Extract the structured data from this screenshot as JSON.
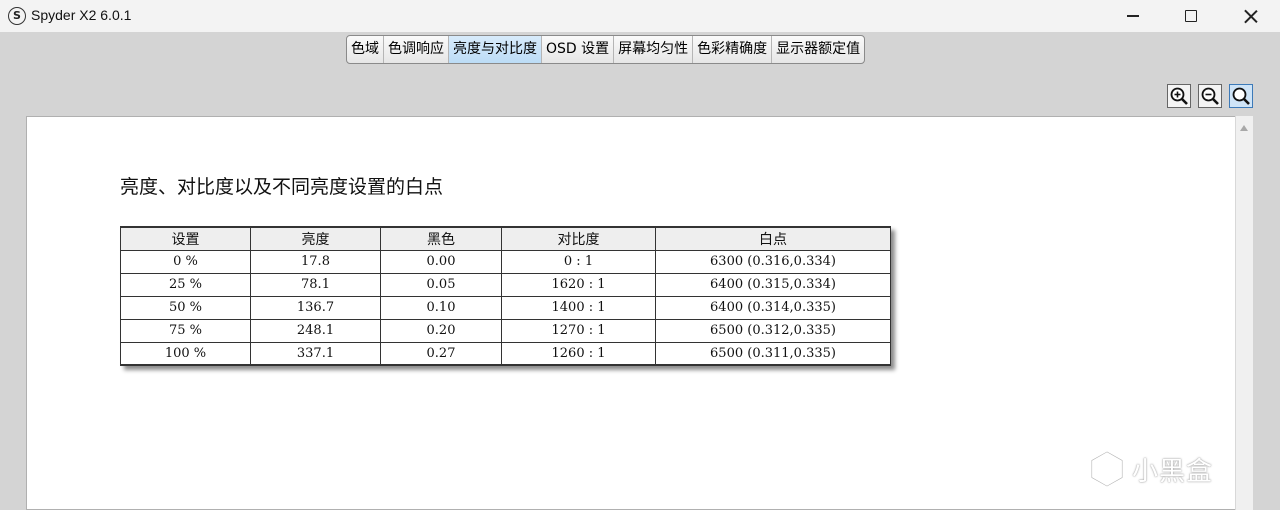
{
  "window": {
    "title": "Spyder X2 6.0.1",
    "app_icon_letter": "S"
  },
  "tabs": [
    {
      "label": "色域",
      "active": false
    },
    {
      "label": "色调响应",
      "active": false
    },
    {
      "label": "亮度与对比度",
      "active": true
    },
    {
      "label": "OSD 设置",
      "active": false
    },
    {
      "label": "屏幕均匀性",
      "active": false
    },
    {
      "label": "色彩精确度",
      "active": false
    },
    {
      "label": "显示器额定值",
      "active": false
    }
  ],
  "zoom_icons": [
    "zoom-in-icon",
    "zoom-out-icon",
    "zoom-fit-icon"
  ],
  "report": {
    "title": "亮度、对比度以及不同亮度设置的白点",
    "columns": [
      "设置",
      "亮度",
      "黑色",
      "对比度",
      "白点"
    ],
    "rows": [
      [
        "0 %",
        "17.8",
        "0.00",
        "0 : 1",
        "6300 (0.316,0.334)"
      ],
      [
        "25 %",
        "78.1",
        "0.05",
        "1620 : 1",
        "6400 (0.315,0.334)"
      ],
      [
        "50 %",
        "136.7",
        "0.10",
        "1400 : 1",
        "6400 (0.314,0.335)"
      ],
      [
        "75 %",
        "248.1",
        "0.20",
        "1270 : 1",
        "6500 (0.312,0.335)"
      ],
      [
        "100 %",
        "337.1",
        "0.27",
        "1260 : 1",
        "6500 (0.311,0.335)"
      ]
    ]
  },
  "watermark": {
    "text": "小黑盒"
  },
  "colors": {
    "active_tab": "#bcdcf6",
    "window_bg": "#d4d4d4",
    "content_bg": "#ffffff"
  }
}
